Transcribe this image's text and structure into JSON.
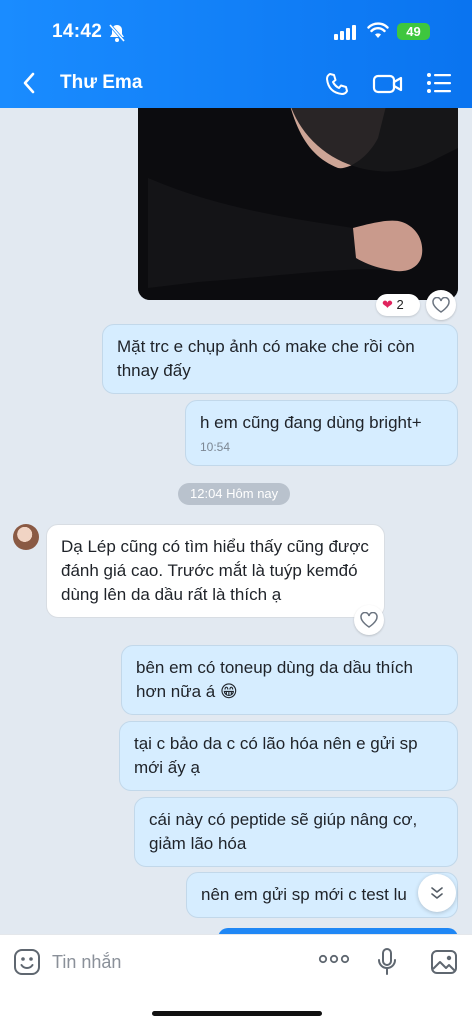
{
  "status_bar": {
    "time": "14:42",
    "battery": "49"
  },
  "header": {
    "contact_name": "Thư Ema"
  },
  "messages": [
    {
      "text": "Mặt trc e chụp ảnh có make che rồi còn thnay đấy"
    },
    {
      "text": "h em cũng đang dùng bright+",
      "time": "10:54"
    },
    {
      "text": "Dạ Lép cũng có tìm hiểu thấy cũng được đánh giá cao. Trước mắt là tuýp kemđó dùng lên da dầu rất là thích ạ"
    },
    {
      "text": "bên em có toneup dùng da dầu thích hơn nữa á 😁"
    },
    {
      "text": "tại c bảo da c có lão hóa nên e gửi sp mới ấy ạ"
    },
    {
      "text": "cái này có peptide sẽ giúp nâng cơ, giảm lão hóa"
    },
    {
      "text": "nên em gửi sp mới c test lu"
    }
  ],
  "photo_reaction": {
    "emoji": "❤",
    "count": "2"
  },
  "time_chip": "12:04 Hôm nay",
  "composer": {
    "placeholder": "Tin nhắn"
  },
  "colors": {
    "header": "#0a74f0",
    "bubble_out": "#d6edff",
    "bubble_in": "#ffffff",
    "background": "#e2e9f1"
  }
}
